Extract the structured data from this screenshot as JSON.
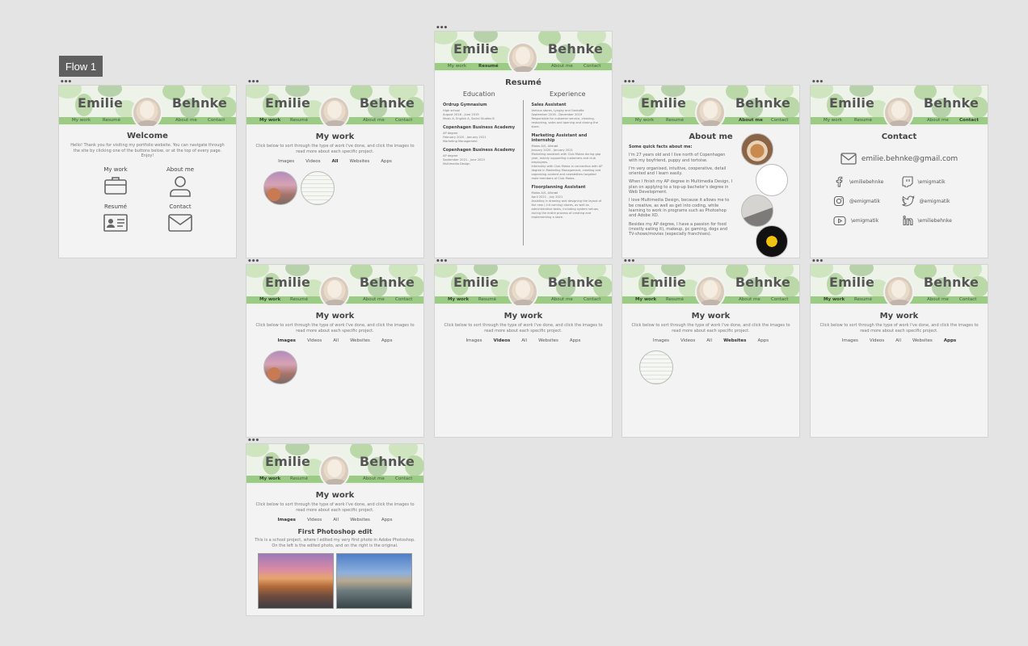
{
  "canvas": {
    "flow_label": "Flow 1",
    "frame_marker": "•••"
  },
  "site": {
    "first_name": "Emilie",
    "last_name": "Behnke",
    "nav": [
      "My work",
      "Resumé",
      "About me",
      "Contact"
    ]
  },
  "welcome": {
    "title": "Welcome",
    "intro": "Hello! Thank you for visiting my portfolio website. You can navigate through the site by clicking one of the buttons below, or at the top of every page. Enjoy!",
    "buttons": [
      "My work",
      "About me",
      "Resumé",
      "Contact"
    ]
  },
  "work": {
    "title": "My work",
    "intro": "Click below to sort through the type of work I've done, and click the images to read more about each specific project.",
    "filters": [
      "Images",
      "Videos",
      "All",
      "Websites",
      "Apps"
    ]
  },
  "project": {
    "title": "First Photoshop edit",
    "desc": "This is a school project, where I edited my very first photo in Adobe Photoshop. On the left is the edited photo, and on the right is the original."
  },
  "resume": {
    "title": "Resumé",
    "education_title": "Education",
    "experience_title": "Experience",
    "education": [
      {
        "name": "Ordrup Gymnasium",
        "lines": [
          "High school",
          "August 2016 - June 2019",
          "Music A, English A, Social Studies B"
        ]
      },
      {
        "name": "Copenhagen Business Academy",
        "lines": [
          "AP degree",
          "February 2020 - January 2021",
          "Marketing Management"
        ]
      },
      {
        "name": "Copenhagen Business Academy",
        "lines": [
          "AP degree",
          "September 2021 - June 2023",
          "Multimedia Design"
        ]
      }
    ],
    "experience": [
      {
        "name": "Sales Assistant",
        "lines": [
          "Various stores, Lyngby and Gentofte",
          "September 2016 - December 2019",
          "Responsible for customer service, cleaning, restocking, sales and opening and closing the store."
        ]
      },
      {
        "name": "Marketing Assistant and internship",
        "lines": [
          "Motas A/S, Allerød",
          "January 2020 - January 2021",
          "Marketing assistant with Club Motas during gap year, mainly supporting customers and club employees.",
          "Internship with Club Motas in connection with AP degree in Marketing Management, creating and organizing content and newsletters targeted male members of Club Motas."
        ]
      },
      {
        "name": "Floorplanning Assistant",
        "lines": [
          "Motas A/S, Allerød",
          "April 2021 - July 2021",
          "Assisting in drawing and designing the layout of the new (–hit coming) stores, as well as administrative tasks, including system setups, during the entire process of creating and implementing a store."
        ]
      }
    ]
  },
  "about": {
    "title": "About me",
    "lead": "Some quick facts about me:",
    "paragraphs": [
      "I'm 27 years old and I live north of Copenhagen with my boyfriend, puppy and tortoise.",
      "I'm very organised, intuitive, cooperative, detail oriented and I learn easily.",
      "When I finish my AP degree in Multimedia Design, I plan on applying to a top-up bachelor's degree in Web Development.",
      "I love Multimedia Design, because it allows me to be creative, as well as get into coding, while learning to work in programs such as Photoshop and Adobe XD.",
      "Besides my AP degree, I have a passion for food (mostly eating it), makeup, pc gaming, dogs and TV-shows/movies (especially franchises)."
    ]
  },
  "contact": {
    "title": "Contact",
    "email": "emilie.behnke@gmail.com",
    "socials": [
      {
        "icon": "facebook-icon",
        "handle": "\\emiliebehnke"
      },
      {
        "icon": "twitch-icon",
        "handle": "\\emigmatik"
      },
      {
        "icon": "instagram-icon",
        "handle": "@emigmatik"
      },
      {
        "icon": "twitter-icon",
        "handle": "@emigmatik"
      },
      {
        "icon": "youtube-icon",
        "handle": "\\emigmatik"
      },
      {
        "icon": "linkedin-icon",
        "handle": "\\emiliebehnke"
      }
    ]
  },
  "colors": {
    "nav_green": "#9ccb86",
    "leaf_green": "#a9cf92",
    "page_bg": "#f3f3f3",
    "canvas_bg": "#e4e4e4"
  }
}
